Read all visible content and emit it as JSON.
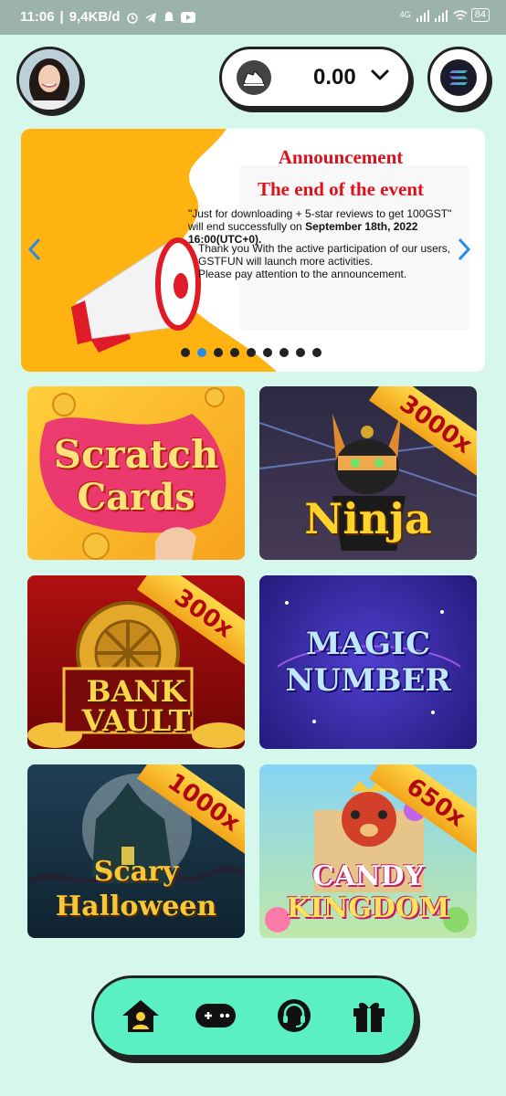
{
  "status_bar": {
    "time": "11:06",
    "speed": "9,4KB/d",
    "network": "4G",
    "battery": "84"
  },
  "header": {
    "balance": "0.00",
    "coin_icon": "shoe-token-icon",
    "network_icon": "solana-icon"
  },
  "banner": {
    "title": "Announcement",
    "subtitle": "The end of the event",
    "paragraph1_a": "\"Just for downloading + 5-star reviews to get 100GST\"",
    "paragraph1_b": "will end successfully on ",
    "paragraph1_bold": "September 18th, 2022 16:00(UTC+0).",
    "paragraph2_line1": "Thank you With the active participation of our users,",
    "paragraph2_line2": "GSTFUN will launch more activities.",
    "paragraph2_line3": "Please pay attention to the announcement.",
    "dots_total": 9,
    "active_dot": 2
  },
  "games": [
    {
      "title_line1": "Scratch",
      "title_line2": "Cards",
      "multiplier": ""
    },
    {
      "title_line1": "Ninja",
      "title_line2": "",
      "multiplier": "3000x"
    },
    {
      "title_line1": "BANK",
      "title_line2": "VAULT",
      "multiplier": "300x"
    },
    {
      "title_line1": "MAGIC",
      "title_line2": "NUMBER",
      "multiplier": ""
    },
    {
      "title_line1": "Scary",
      "title_line2": "Halloween",
      "multiplier": "1000x"
    },
    {
      "title_line1": "CANDY",
      "title_line2": "KINGDOM",
      "multiplier": "650x"
    }
  ],
  "nav": {
    "items": [
      "home-user-icon",
      "gamepad-icon",
      "headset-icon",
      "gift-icon"
    ]
  }
}
